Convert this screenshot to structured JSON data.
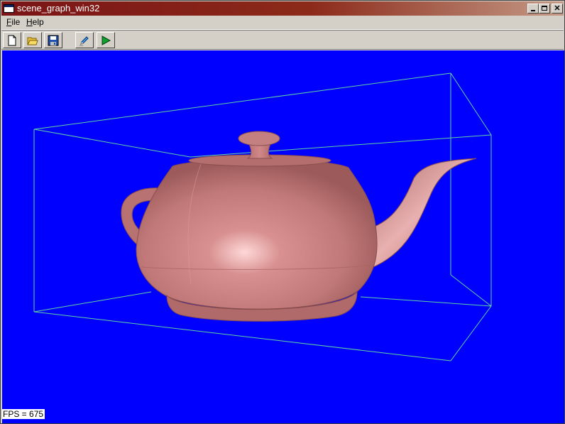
{
  "window": {
    "title": "scene_graph_win32",
    "caption_buttons": [
      "minimize-icon",
      "maximize-icon",
      "close-icon"
    ]
  },
  "menu": {
    "file": {
      "accel": "F",
      "rest": "ile"
    },
    "help": {
      "accel": "H",
      "rest": "elp"
    }
  },
  "toolbar": {
    "buttons": [
      "new-document-icon",
      "open-folder-icon",
      "save-disk-icon",
      "edit-pencil-icon",
      "play-icon"
    ]
  },
  "viewport": {
    "background": "#0000ff",
    "bounding_box_color": "#5fd2a0",
    "model": "teapot",
    "model_color": "#c07878"
  },
  "status": {
    "fps_text": "FPS = 675"
  },
  "close_glyph": "✕"
}
